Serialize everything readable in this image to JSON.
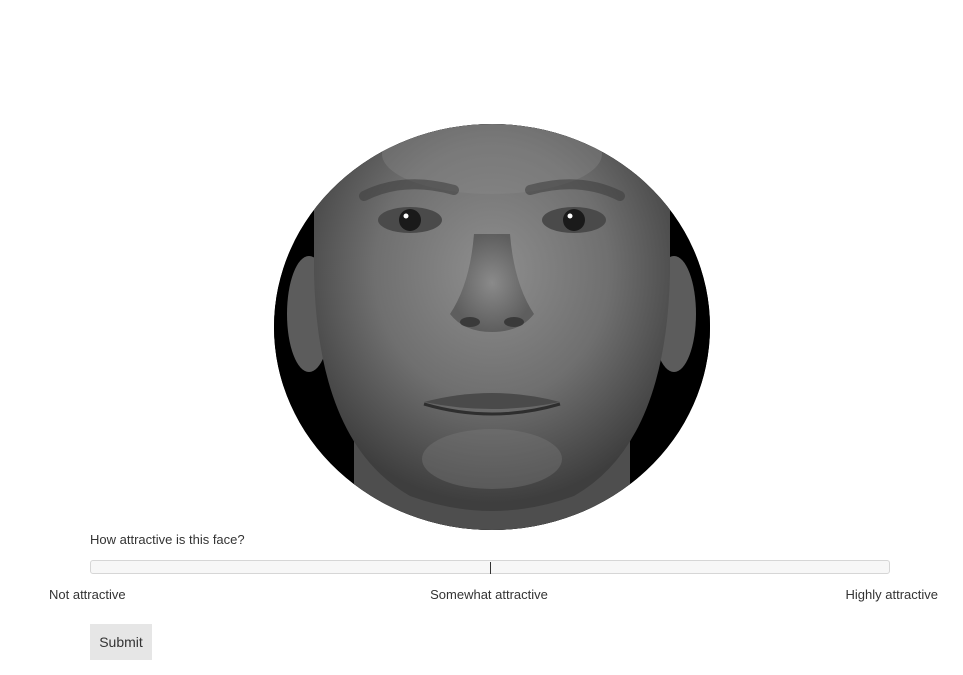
{
  "stimulus": {
    "image_subject": "grayscale male face"
  },
  "rating": {
    "question": "How attractive is this face?",
    "value_fraction": 0.5,
    "labels": {
      "low": "Not attractive",
      "mid": "Somewhat attractive",
      "high": "Highly attractive"
    }
  },
  "form": {
    "submit_label": "Submit"
  },
  "colors": {
    "track_background": "#f7f7f7",
    "track_border": "#d6d6d6",
    "button_background": "#e6e6e6",
    "text": "#333333"
  }
}
